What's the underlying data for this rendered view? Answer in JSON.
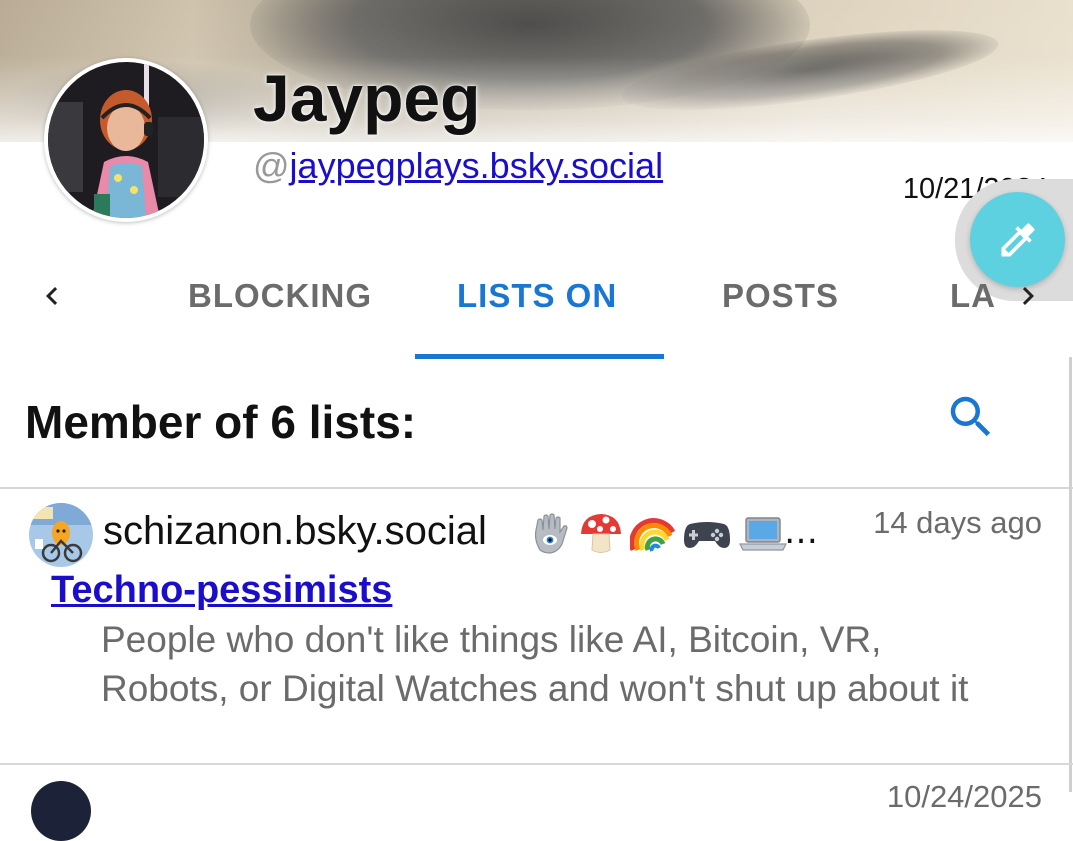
{
  "profile": {
    "display_name": "Jaypeg",
    "handle_prefix": "@",
    "handle": "jaypegplays.bsky.social",
    "date": "10/21/2024"
  },
  "fab": {
    "icon": "eyedropper-icon",
    "color": "#5ed1e0"
  },
  "tabs": {
    "prev_icon": "chevron-left-icon",
    "next_icon": "chevron-right-icon",
    "items": [
      {
        "label": "BLOCKING",
        "active": false
      },
      {
        "label": "LISTS ON",
        "active": true
      },
      {
        "label": "POSTS",
        "active": false
      },
      {
        "label": "LA",
        "active": false
      }
    ],
    "accent": "#1976d2"
  },
  "list_section": {
    "title": "Member of 6 lists:",
    "search_icon": "search-icon"
  },
  "lists": [
    {
      "author": "schizanon.bsky.social",
      "author_suffix_emoji": [
        "🪬",
        "🍄",
        "🌈",
        "🎮",
        "💻"
      ],
      "author_ellipsis": "…",
      "time": "14 days ago",
      "name": "Techno-pessimists",
      "description": "People who don't like things like AI, Bitcoin, VR, Robots, or Digital Watches and won't shut up about it"
    },
    {
      "time": "10/24/2025"
    }
  ]
}
